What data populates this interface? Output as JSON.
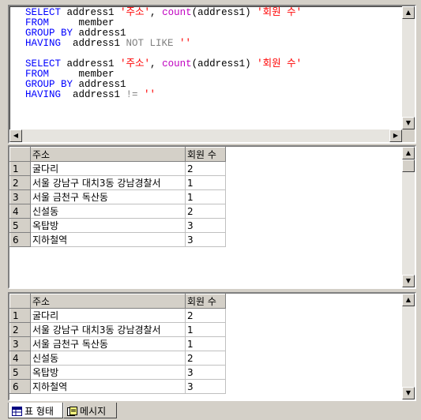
{
  "editor": {
    "q1": {
      "l1a": "SELECT",
      "l1b": " address1 ",
      "l1c": "'주소'",
      "l1d": ", ",
      "l1e": "count",
      "l1f": "(address1) ",
      "l1g": "'회원 수'",
      "l2a": "FROM",
      "l2b": "     member",
      "l3a": "GROUP BY",
      "l3b": " address1",
      "l4a": "HAVING",
      "l4b": "  address1 ",
      "l4c": "NOT LIKE",
      "l4d": " ''"
    },
    "q2": {
      "l1a": "SELECT",
      "l1b": " address1 ",
      "l1c": "'주소'",
      "l1d": ", ",
      "l1e": "count",
      "l1f": "(address1) ",
      "l1g": "'회원 수'",
      "l2a": "FROM",
      "l2b": "     member",
      "l3a": "GROUP BY",
      "l3b": " address1",
      "l4a": "HAVING",
      "l4b": "  address1 ",
      "l4c": "!=",
      "l4d": " ''"
    }
  },
  "grid1": {
    "columns": [
      "주소",
      "회원 수"
    ],
    "rows": [
      {
        "n": "1",
        "addr": "굴다리",
        "cnt": "2"
      },
      {
        "n": "2",
        "addr": "서울 강남구 대치3동 강남경찰서",
        "cnt": "1"
      },
      {
        "n": "3",
        "addr": "서울 금천구 독산동",
        "cnt": "1"
      },
      {
        "n": "4",
        "addr": "신설동",
        "cnt": "2"
      },
      {
        "n": "5",
        "addr": "옥탑방",
        "cnt": "3"
      },
      {
        "n": "6",
        "addr": "지하철역",
        "cnt": "3"
      }
    ]
  },
  "grid2": {
    "columns": [
      "주소",
      "회원 수"
    ],
    "rows": [
      {
        "n": "1",
        "addr": "굴다리",
        "cnt": "2"
      },
      {
        "n": "2",
        "addr": "서울 강남구 대치3동 강남경찰서",
        "cnt": "1"
      },
      {
        "n": "3",
        "addr": "서울 금천구 독산동",
        "cnt": "1"
      },
      {
        "n": "4",
        "addr": "신설동",
        "cnt": "2"
      },
      {
        "n": "5",
        "addr": "옥탑방",
        "cnt": "3"
      },
      {
        "n": "6",
        "addr": "지하철역",
        "cnt": "3"
      }
    ]
  },
  "tabs": {
    "grid_label": "표 형태",
    "messages_label": "메시지"
  },
  "icons": {
    "grid_tab": "grid-icon",
    "messages_tab": "messages-icon",
    "scroll_up": "arrow-up-icon",
    "scroll_down": "arrow-down-icon",
    "scroll_left": "arrow-left-icon",
    "scroll_right": "arrow-right-icon"
  },
  "colors": {
    "keyword": "#0000ff",
    "function": "#c000c0",
    "string": "#ff0000",
    "operator": "#808080"
  }
}
